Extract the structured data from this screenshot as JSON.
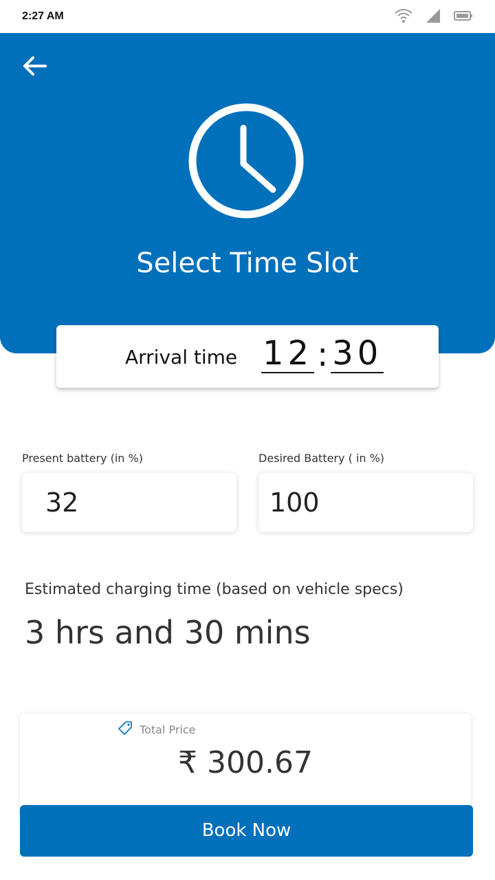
{
  "status_bar": {
    "time": "2:27 AM",
    "icons": [
      "wifi-icon",
      "signal-icon",
      "battery-icon"
    ]
  },
  "header": {
    "back_icon": "back-arrow-icon",
    "clock_icon": "clock-icon",
    "title": "Select Time Slot",
    "background_color": "#0170BB"
  },
  "arrival": {
    "label": "Arrival time",
    "hours": "12",
    "minutes": "30"
  },
  "battery": {
    "present_label": "Present battery (in %)",
    "present_value": "32",
    "desired_label": "Desired Battery ( in %)",
    "desired_value": "100"
  },
  "estimate": {
    "label": "Estimated charging time (based on vehicle specs)",
    "value": "3 hrs and 30 mins"
  },
  "price": {
    "icon": "price-tag-icon",
    "label": "Total Price",
    "value": "₹ 300.67"
  },
  "book_button": {
    "label": "Book Now",
    "color": "#0170BB"
  }
}
